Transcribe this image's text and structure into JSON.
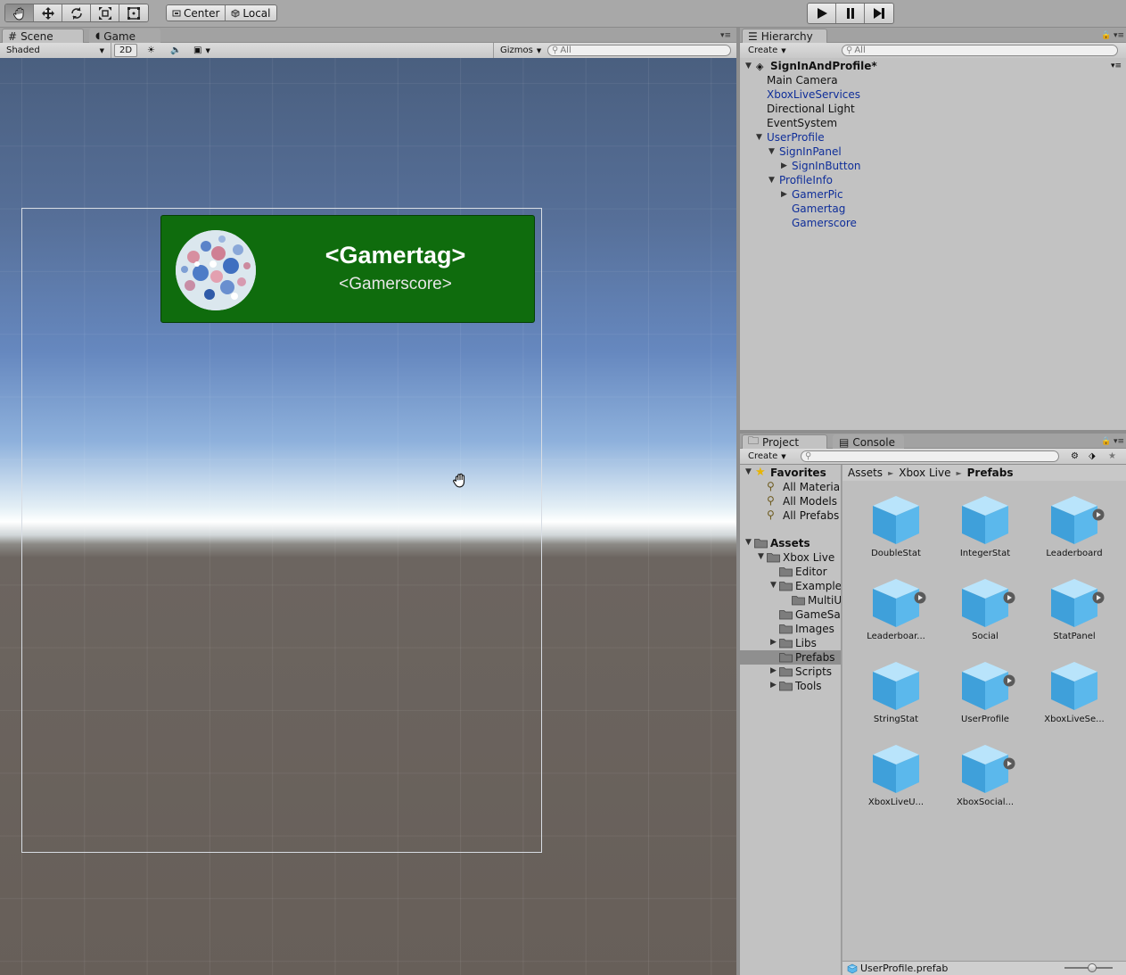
{
  "toolbar": {
    "tools": [
      "hand-tool",
      "move-tool",
      "rotate-tool",
      "scale-tool",
      "rect-tool"
    ],
    "pivot_mode": "Center",
    "pivot_rotation": "Local",
    "play_controls": [
      "play",
      "pause",
      "step"
    ]
  },
  "scene_panel": {
    "tabs": [
      {
        "label": "Scene",
        "icon": "grid-icon",
        "active": true
      },
      {
        "label": "Game",
        "icon": "pacman-icon",
        "active": false
      }
    ],
    "shading_mode": "Shaded",
    "mode_2d_label": "2D",
    "gizmos_label": "Gizmos",
    "search_placeholder": "All"
  },
  "scene_content": {
    "gamertag": "<Gamertag>",
    "gamerscore": "<Gamerscore>"
  },
  "hierarchy": {
    "tab_label": "Hierarchy",
    "create_label": "Create",
    "search_placeholder": "All",
    "scene_name": "SignInAndProfile*",
    "items": [
      {
        "label": "Main Camera",
        "depth": 0,
        "expander": "",
        "prefab": false
      },
      {
        "label": "XboxLiveServices",
        "depth": 0,
        "expander": "",
        "prefab": true
      },
      {
        "label": "Directional Light",
        "depth": 0,
        "expander": "",
        "prefab": false
      },
      {
        "label": "EventSystem",
        "depth": 0,
        "expander": "",
        "prefab": false
      },
      {
        "label": "UserProfile",
        "depth": 0,
        "expander": "expanded",
        "prefab": true
      },
      {
        "label": "SignInPanel",
        "depth": 1,
        "expander": "expanded",
        "prefab": true
      },
      {
        "label": "SignInButton",
        "depth": 2,
        "expander": "collapsed",
        "prefab": true
      },
      {
        "label": "ProfileInfo",
        "depth": 1,
        "expander": "expanded",
        "prefab": true
      },
      {
        "label": "GamerPic",
        "depth": 2,
        "expander": "collapsed",
        "prefab": true
      },
      {
        "label": "Gamertag",
        "depth": 2,
        "expander": "",
        "prefab": true
      },
      {
        "label": "Gamerscore",
        "depth": 2,
        "expander": "",
        "prefab": true
      }
    ]
  },
  "project": {
    "tabs": [
      {
        "label": "Project",
        "icon": "folder-icon",
        "active": true
      },
      {
        "label": "Console",
        "icon": "console-icon",
        "active": false
      }
    ],
    "create_label": "Create",
    "favorites_label": "Favorites",
    "favorites": [
      "All Materials",
      "All Models",
      "All Prefabs"
    ],
    "assets_label": "Assets",
    "folders": [
      {
        "label": "Xbox Live",
        "depth": 1,
        "expander": "expanded",
        "selected": false
      },
      {
        "label": "Editor",
        "depth": 2,
        "expander": "",
        "selected": false
      },
      {
        "label": "Examples",
        "depth": 2,
        "expander": "expanded",
        "selected": false
      },
      {
        "label": "MultiUs",
        "depth": 3,
        "expander": "",
        "selected": false
      },
      {
        "label": "GameSav",
        "depth": 2,
        "expander": "",
        "selected": false
      },
      {
        "label": "Images",
        "depth": 2,
        "expander": "",
        "selected": false
      },
      {
        "label": "Libs",
        "depth": 2,
        "expander": "collapsed",
        "selected": false
      },
      {
        "label": "Prefabs",
        "depth": 2,
        "expander": "",
        "selected": true
      },
      {
        "label": "Scripts",
        "depth": 2,
        "expander": "collapsed",
        "selected": false
      },
      {
        "label": "Tools",
        "depth": 2,
        "expander": "collapsed",
        "selected": false
      }
    ],
    "breadcrumb": [
      "Assets",
      "Xbox Live",
      "Prefabs"
    ],
    "assets": [
      {
        "label": "DoubleStat",
        "has_children": false
      },
      {
        "label": "IntegerStat",
        "has_children": false
      },
      {
        "label": "Leaderboard",
        "has_children": true
      },
      {
        "label": "Leaderboar...",
        "has_children": true
      },
      {
        "label": "Social",
        "has_children": true
      },
      {
        "label": "StatPanel",
        "has_children": true
      },
      {
        "label": "StringStat",
        "has_children": false
      },
      {
        "label": "UserProfile",
        "has_children": true
      },
      {
        "label": "XboxLiveSe...",
        "has_children": false
      },
      {
        "label": "XboxLiveU...",
        "has_children": false
      },
      {
        "label": "XboxSocial...",
        "has_children": true
      }
    ],
    "selected_file": "UserProfile.prefab"
  },
  "colors": {
    "profile_card": "#0f6c0d",
    "prefab_text": "#0f2e99",
    "cube_top": "#b9e4fb",
    "cube_left": "#3fa0da",
    "cube_right": "#5bb8ec"
  }
}
